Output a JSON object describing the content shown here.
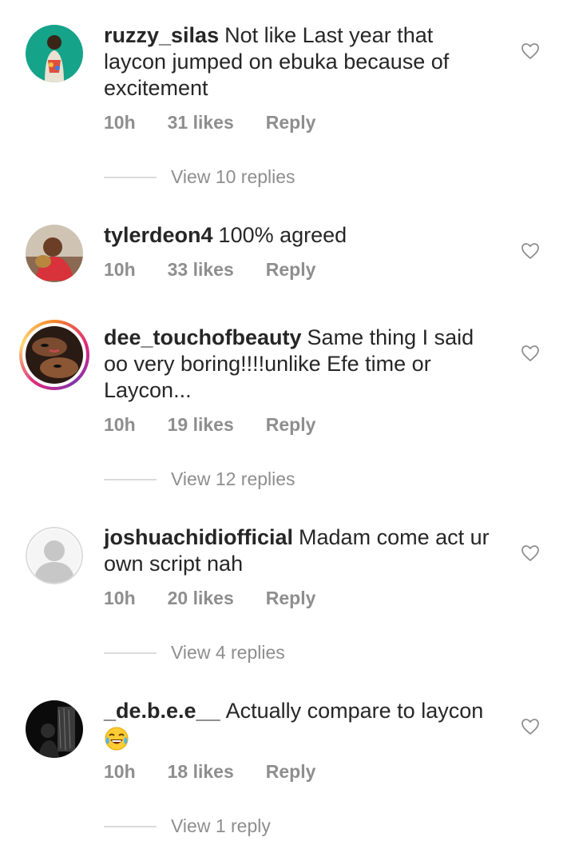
{
  "comments": [
    {
      "username": "ruzzy_silas",
      "text": "Not like Last year that laycon jumped on ebuka because of excitement",
      "time": "10h",
      "likes": "31 likes",
      "reply": "Reply",
      "view_replies": "View 10 replies",
      "avatar": "photo-woman-teal-bg"
    },
    {
      "username": "tylerdeon4",
      "text": "100% agreed",
      "time": "10h",
      "likes": "33 likes",
      "reply": "Reply",
      "avatar": "photo-child-with-toy"
    },
    {
      "username": "dee_touchofbeauty",
      "text": "Same thing I said oo very boring!!!!unlike Efe time or Laycon...",
      "time": "10h",
      "likes": "19 likes",
      "reply": "Reply",
      "view_replies": "View 12 replies",
      "avatar": "photo-makeup-faces-story-ring"
    },
    {
      "username": "joshuachidiofficial",
      "text": "Madam come act ur own script nah",
      "time": "10h",
      "likes": "20 likes",
      "reply": "Reply",
      "view_replies": "View 4 replies",
      "avatar": "default-user-silhouette"
    },
    {
      "username": "_de.b.e.e__",
      "text": "Actually compare to laycon",
      "emoji": "face-with-tears-of-joy",
      "time": "10h",
      "likes": "18 likes",
      "reply": "Reply",
      "view_replies": "View 1 reply",
      "avatar": "photo-dark-room"
    }
  ],
  "icons": {
    "like": "heart-outline-icon"
  },
  "colors": {
    "text": "#262626",
    "secondary": "#8e8e8e",
    "divider": "#dbdbdb"
  }
}
